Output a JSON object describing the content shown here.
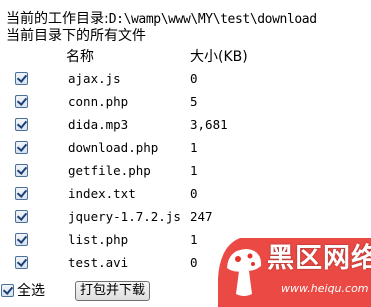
{
  "header": {
    "current_dir_label": "当前的工作目录:",
    "current_dir_path": "D:\\wamp\\www\\MY\\test\\download",
    "all_files_label": "当前目录下的所有文件"
  },
  "columns": {
    "name": "名称",
    "size": "大小(KB)"
  },
  "files": [
    {
      "name": "ajax.js",
      "size": "0",
      "checked": true
    },
    {
      "name": "conn.php",
      "size": "5",
      "checked": true
    },
    {
      "name": "dida.mp3",
      "size": "3,681",
      "checked": true
    },
    {
      "name": "download.php",
      "size": "1",
      "checked": true
    },
    {
      "name": "getfile.php",
      "size": "1",
      "checked": true
    },
    {
      "name": "index.txt",
      "size": "0",
      "checked": true
    },
    {
      "name": "jquery-1.7.2.js",
      "size": "247",
      "checked": true
    },
    {
      "name": "list.php",
      "size": "1",
      "checked": true
    },
    {
      "name": "test.avi",
      "size": "0",
      "checked": true
    }
  ],
  "footer": {
    "select_all_label": "全选",
    "select_all_checked": true,
    "pack_button_label": "打包并下载"
  },
  "watermark": {
    "logo_text": "黑区网络",
    "url": "www.heiqu.com",
    "icon": "mushroom-logo-icon",
    "color": "#e8312a"
  }
}
